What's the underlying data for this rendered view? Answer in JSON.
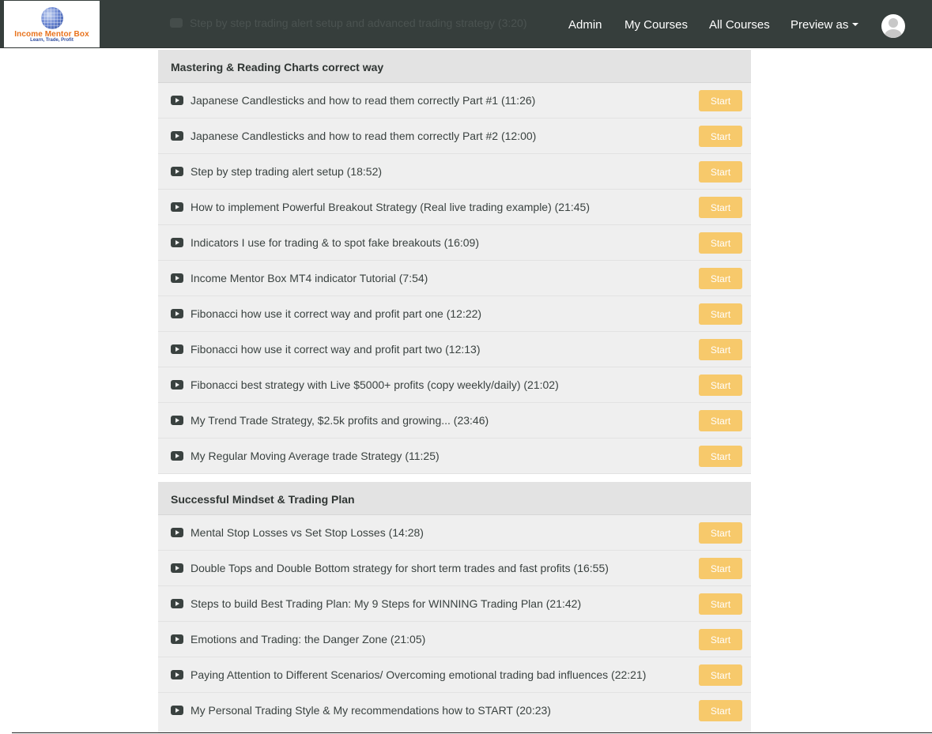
{
  "brand": {
    "name": "Income Mentor Box",
    "tagline": "Learn, Trade, Profit"
  },
  "nav": {
    "admin": "Admin",
    "my_courses": "My Courses",
    "all_courses": "All Courses",
    "preview_as": "Preview as"
  },
  "ghost_row": "Step by step trading alert setup and advanced trading strategy (3:20)",
  "start_label": "Start",
  "sections": [
    {
      "title": "Mastering & Reading Charts correct way",
      "lectures": [
        "Japanese Candlesticks and how to read them correctly Part #1 (11:26)",
        "Japanese Candlesticks and how to read them correctly Part #2 (12:00)",
        "Step by step trading alert setup (18:52)",
        "How to implement Powerful Breakout Strategy (Real live trading example) (21:45)",
        "Indicators I use for trading & to spot fake breakouts (16:09)",
        "Income Mentor Box MT4 indicator Tutorial (7:54)",
        "Fibonacci how use it correct way and profit part one (12:22)",
        "Fibonacci how use it correct way and profit part two (12:13)",
        "Fibonacci best strategy with Live $5000+ profits (copy weekly/daily) (21:02)",
        "My Trend Trade Strategy, $2.5k profits and growing... (23:46)",
        "My Regular Moving Average trade Strategy (11:25)"
      ]
    },
    {
      "title": "Successful Mindset & Trading Plan",
      "lectures": [
        "Mental Stop Losses vs Set Stop Losses (14:28)",
        "Double Tops and Double Bottom strategy for short term trades and fast profits (16:55)",
        "Steps to build Best Trading Plan: My 9 Steps for WINNING Trading Plan (21:42)",
        "Emotions and Trading: the Danger Zone (21:05)",
        "Paying Attention to Different Scenarios/ Overcoming emotional trading bad influences (22:21)",
        "My Personal Trading Style & My recommendations how to START (20:23)"
      ]
    }
  ]
}
